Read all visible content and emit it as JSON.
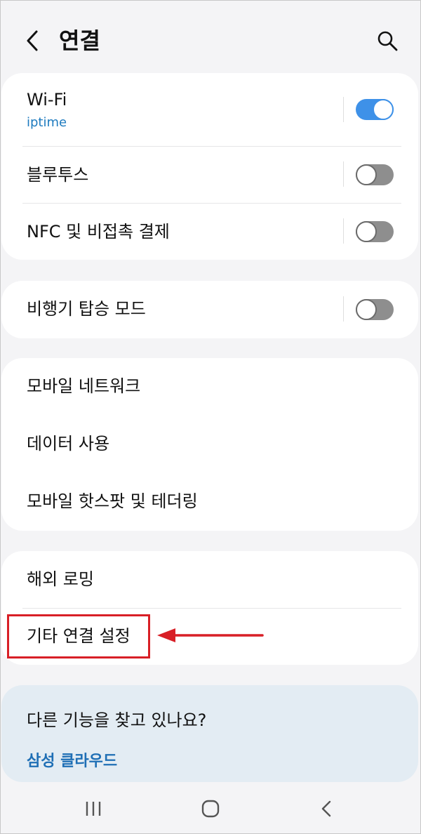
{
  "header": {
    "title": "연결",
    "back_icon": "chevron-left-icon",
    "search_icon": "search-icon"
  },
  "colors": {
    "accent": "#3e91e8",
    "link": "#1f6fb5",
    "highlight": "#d81f26",
    "background": "#f4f4f6"
  },
  "group1": {
    "wifi": {
      "label": "Wi-Fi",
      "network": "iptime",
      "enabled": true
    },
    "bluetooth": {
      "label": "블루투스",
      "enabled": false
    },
    "nfc": {
      "label": "NFC 및 비접촉 결제",
      "enabled": false
    }
  },
  "group2": {
    "airplane": {
      "label": "비행기 탑승 모드",
      "enabled": false
    }
  },
  "group3": {
    "items": [
      {
        "label": "모바일 네트워크"
      },
      {
        "label": "데이터 사용"
      },
      {
        "label": "모바일 핫스팟 및 테더링"
      }
    ]
  },
  "group4": {
    "items": [
      {
        "label": "해외 로밍"
      },
      {
        "label": "기타 연결 설정"
      }
    ]
  },
  "suggestion": {
    "title": "다른 기능을 찾고 있나요?",
    "link": "삼성 클라우드"
  },
  "navbar": {
    "icons": [
      "recent-apps-icon",
      "home-icon",
      "back-icon"
    ]
  }
}
